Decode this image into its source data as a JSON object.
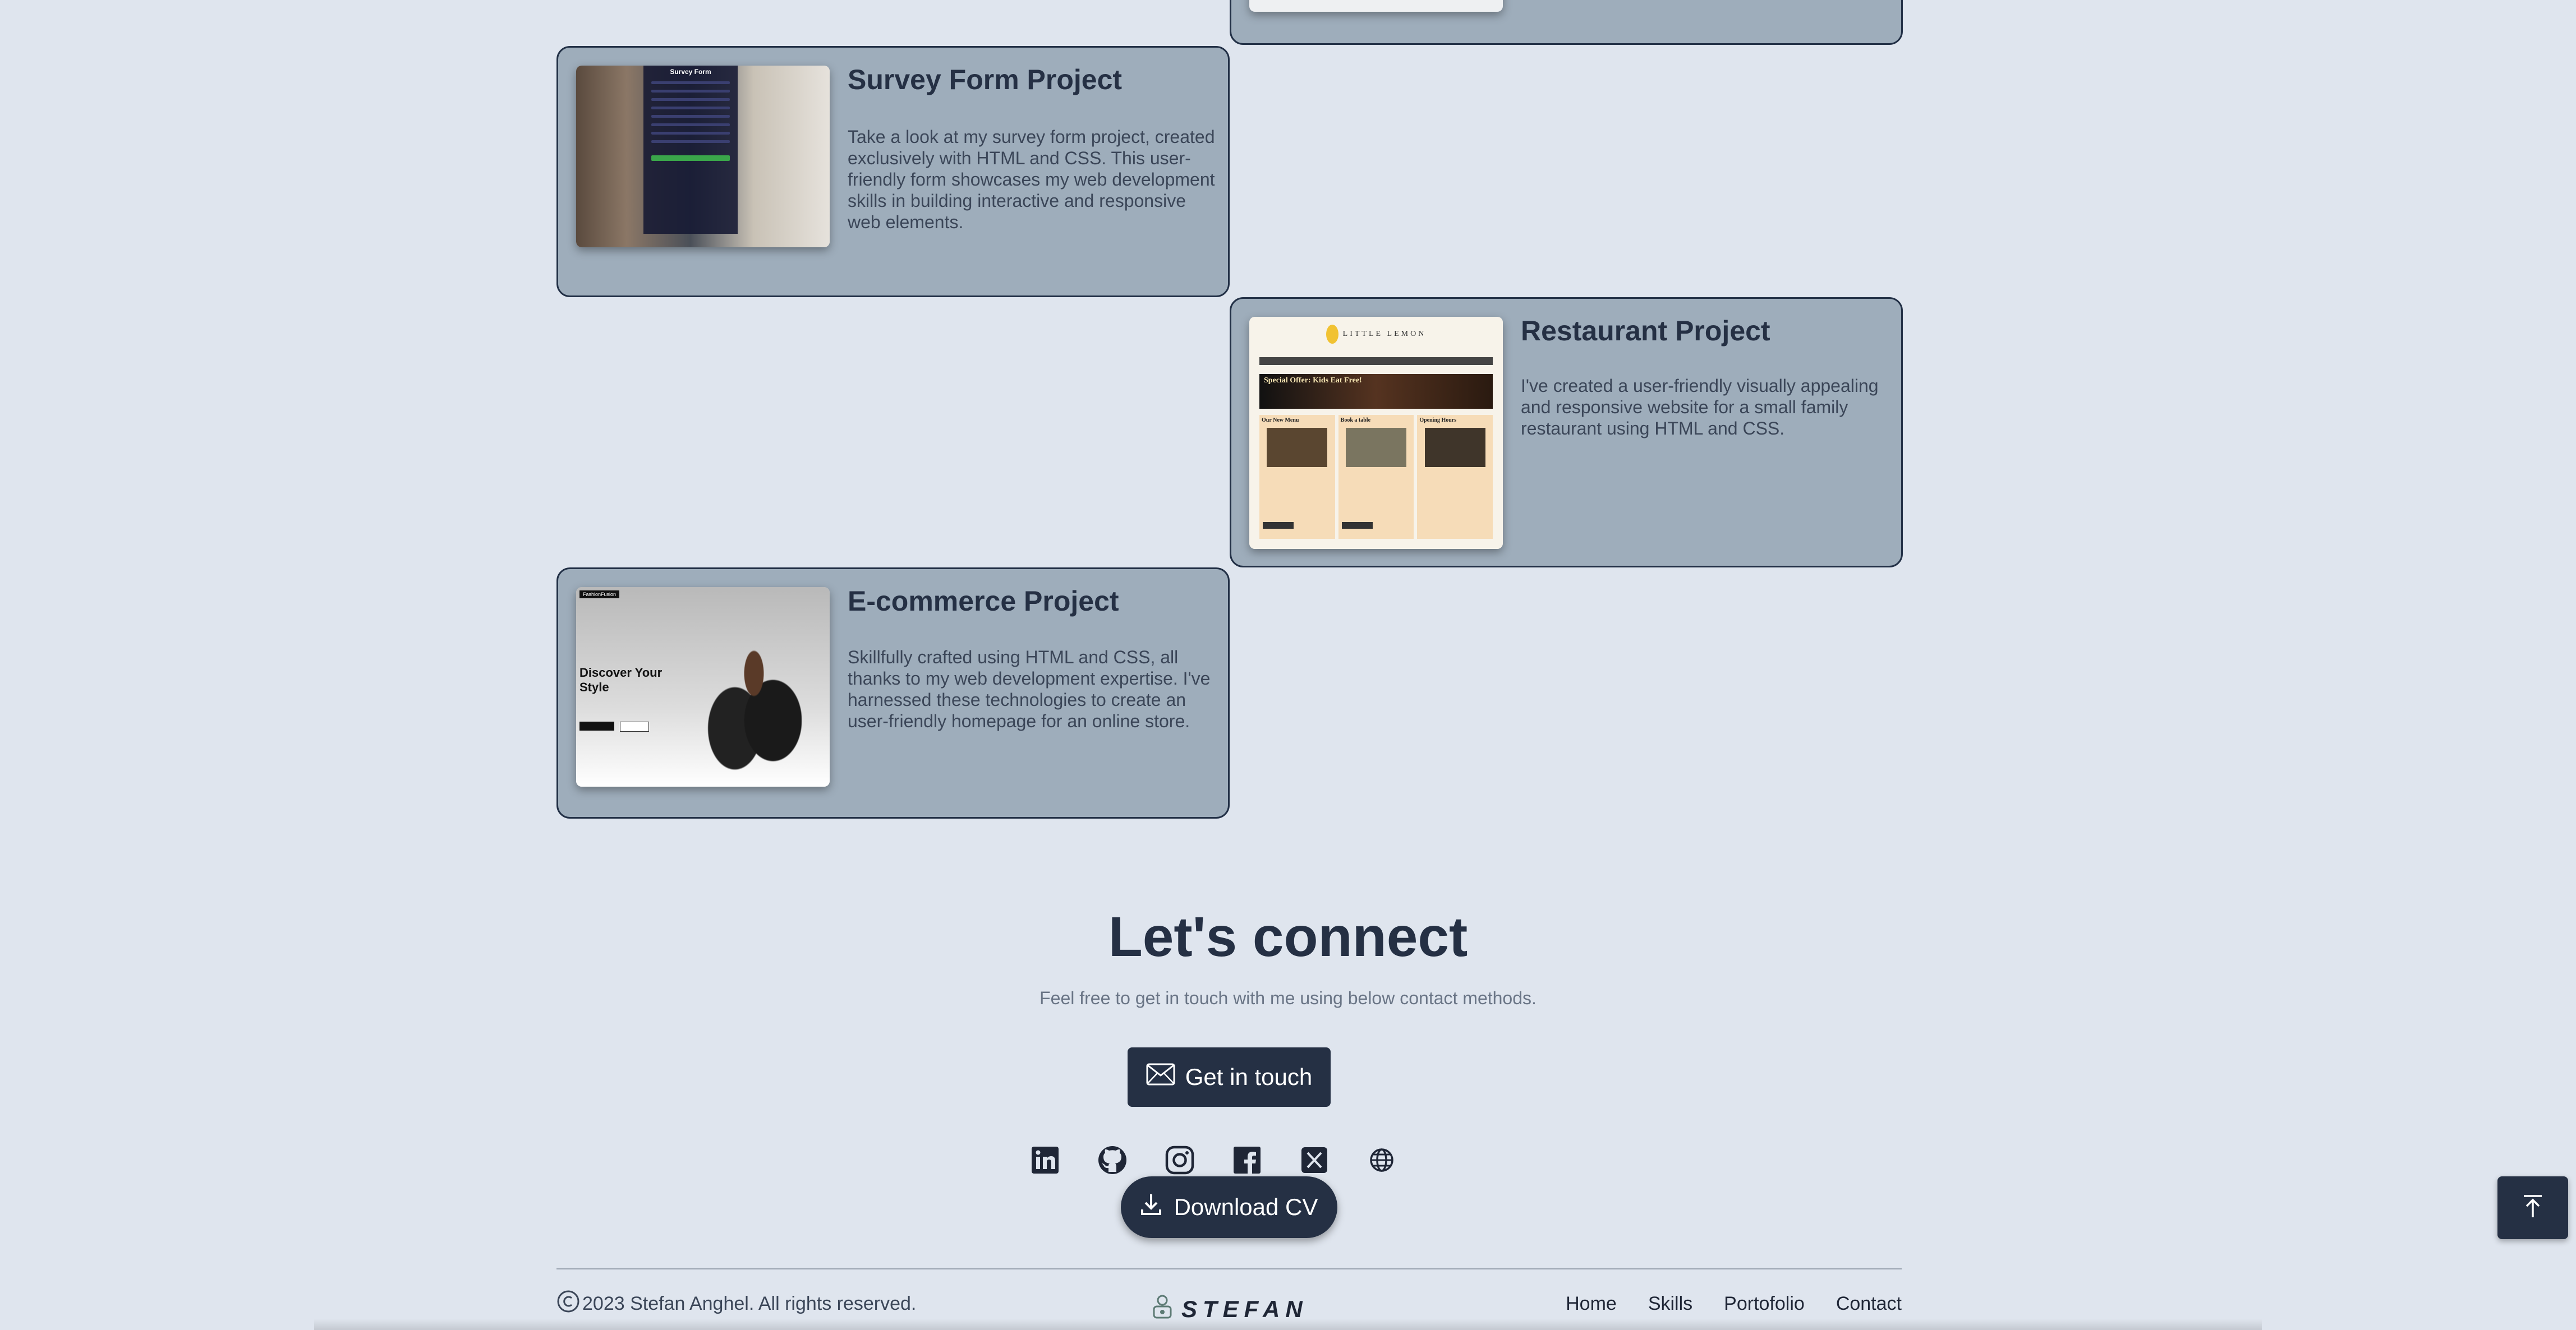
{
  "projects": [
    {
      "title": "Survey Form Project",
      "description": "Take a look at my survey form project, created exclusively with HTML and CSS. This user-friendly form showcases my web development skills in building interactive and responsive web elements.",
      "thumb_text": "Survey Form"
    },
    {
      "title": "Restaurant Project",
      "description": "I've created a user-friendly visually appealing and responsive website for a small family restaurant using HTML and CSS.",
      "thumb_logo": "LITTLE LEMON",
      "thumb_hero": "Special Offer: Kids Eat Free!",
      "thumb_cols": [
        "Our New Menu",
        "Book a table",
        "Opening Hours"
      ]
    },
    {
      "title": "E-commerce Project",
      "description": "Skillfully crafted using HTML and CSS, all thanks to my web development expertise. I've harnessed these technologies to create an user-friendly homepage for an online store.",
      "thumb_brand": "FashionFusion",
      "thumb_heading": "Discover Your Style"
    }
  ],
  "connect": {
    "title": "Let's connect",
    "subtitle": "Feel free to get in touch with me using below contact methods.",
    "button_label": "Get in touch",
    "download_label": "Download CV"
  },
  "social_icons": [
    "linkedin-icon",
    "github-icon",
    "instagram-icon",
    "facebook-icon",
    "x-icon",
    "globe-icon"
  ],
  "footer": {
    "copyright": "2023 Stefan Anghel. All rights reserved.",
    "logo": "STEFAN",
    "nav": [
      "Home",
      "Skills",
      "Portofolio",
      "Contact"
    ]
  },
  "colors": {
    "background": "#dfe5ee",
    "card": "#9eadbb",
    "dark": "#253044"
  }
}
